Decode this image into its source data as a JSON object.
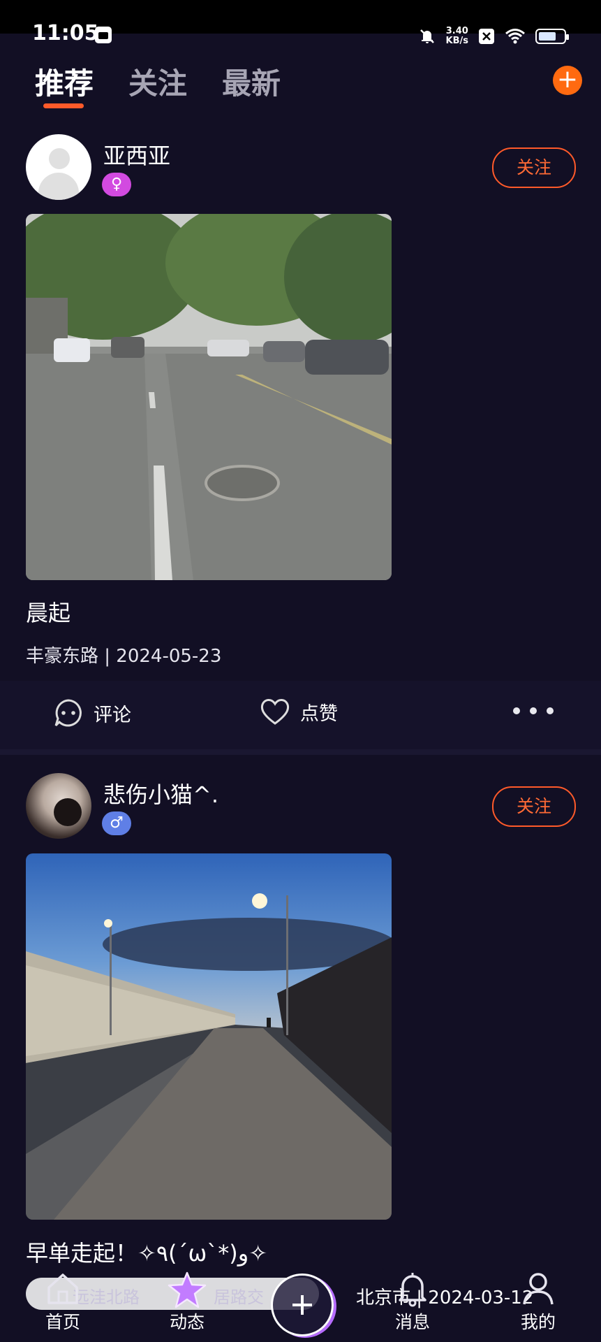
{
  "status_bar": {
    "time": "11:05",
    "net_speed_value": "3.40",
    "net_speed_unit": "KB/s",
    "icons": [
      "calendar-icon",
      "mute-icon",
      "close-box-icon",
      "wifi-icon",
      "battery-icon"
    ]
  },
  "tabs": [
    {
      "label": "推荐",
      "active": true
    },
    {
      "label": "关注",
      "active": false
    },
    {
      "label": "最新",
      "active": false
    }
  ],
  "colors": {
    "background": "#120f24",
    "accent": "#ff5a2a",
    "female_badge": "#d24ae0",
    "male_badge": "#5f7fe6"
  },
  "posts": [
    {
      "username": "亚西亚",
      "gender_icon": "female-icon",
      "follow_label": "关注",
      "caption": "晨起",
      "meta": "丰豪东路 | 2024-05-23",
      "comment_label": "评论",
      "like_label": "点赞"
    },
    {
      "username": "悲伤小猫^.",
      "gender_icon": "male-icon",
      "follow_label": "关注",
      "caption": "早单走起！✧٩(ˊωˋ*)و✧",
      "meta_partial": "北京市 | 2024-03-12",
      "overlay_fragments": [
        "远洼北路",
        "居路交"
      ]
    }
  ],
  "bottom_nav": [
    {
      "label": "首页",
      "icon": "home-icon"
    },
    {
      "label": "动态",
      "icon": "star-icon"
    },
    {
      "label": "消息",
      "icon": "bell-icon"
    },
    {
      "label": "我的",
      "icon": "user-icon"
    }
  ]
}
